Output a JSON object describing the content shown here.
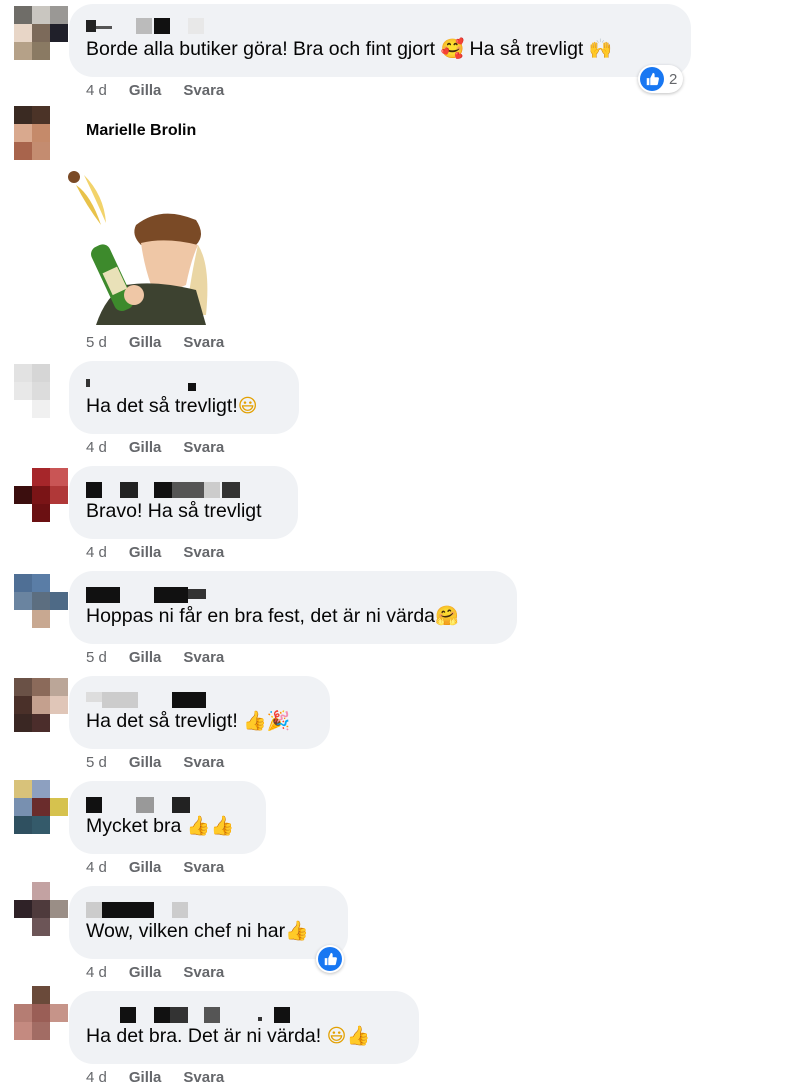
{
  "comments": [
    {
      "text": "Borde alla butiker göra! Bra och fint gjort",
      "emoji1": "🥰",
      "text2": " Ha så trevligt",
      "emoji2": "🙌",
      "time": "4 d",
      "like": "Gilla",
      "reply": "Svara",
      "reaction_count": "2"
    },
    {
      "name": "Marielle Brolin",
      "time": "5 d",
      "like": "Gilla",
      "reply": "Svara"
    },
    {
      "text": "Ha det så trevligt!",
      "emoji1": "😃",
      "time": "4 d",
      "like": "Gilla",
      "reply": "Svara"
    },
    {
      "text": "Bravo! Ha så trevligt",
      "time": "4 d",
      "like": "Gilla",
      "reply": "Svara"
    },
    {
      "text": "Hoppas ni får en bra fest, det är ni värda",
      "emoji1": "🤗",
      "time": "5 d",
      "like": "Gilla",
      "reply": "Svara"
    },
    {
      "text": "Ha det så trevligt! ",
      "emoji1": "👍",
      "emoji2": "🎉",
      "time": "5 d",
      "like": "Gilla",
      "reply": "Svara"
    },
    {
      "text": "Mycket bra ",
      "emoji1": "👍",
      "emoji2": "👍",
      "time": "4 d",
      "like": "Gilla",
      "reply": "Svara"
    },
    {
      "text": "Wow, vilken chef ni har",
      "emoji1": "👍",
      "time": "4 d",
      "like": "Gilla",
      "reply": "Svara"
    },
    {
      "text": "Ha det bra. Det är ni värda! ",
      "emoji1": "😃",
      "emoji2": "👍",
      "time": "4 d",
      "like": "Gilla",
      "reply": "Svara"
    }
  ],
  "colors": {
    "bubble": "#f0f2f5",
    "meta": "#65676b",
    "like_blue": "#1877f2"
  }
}
